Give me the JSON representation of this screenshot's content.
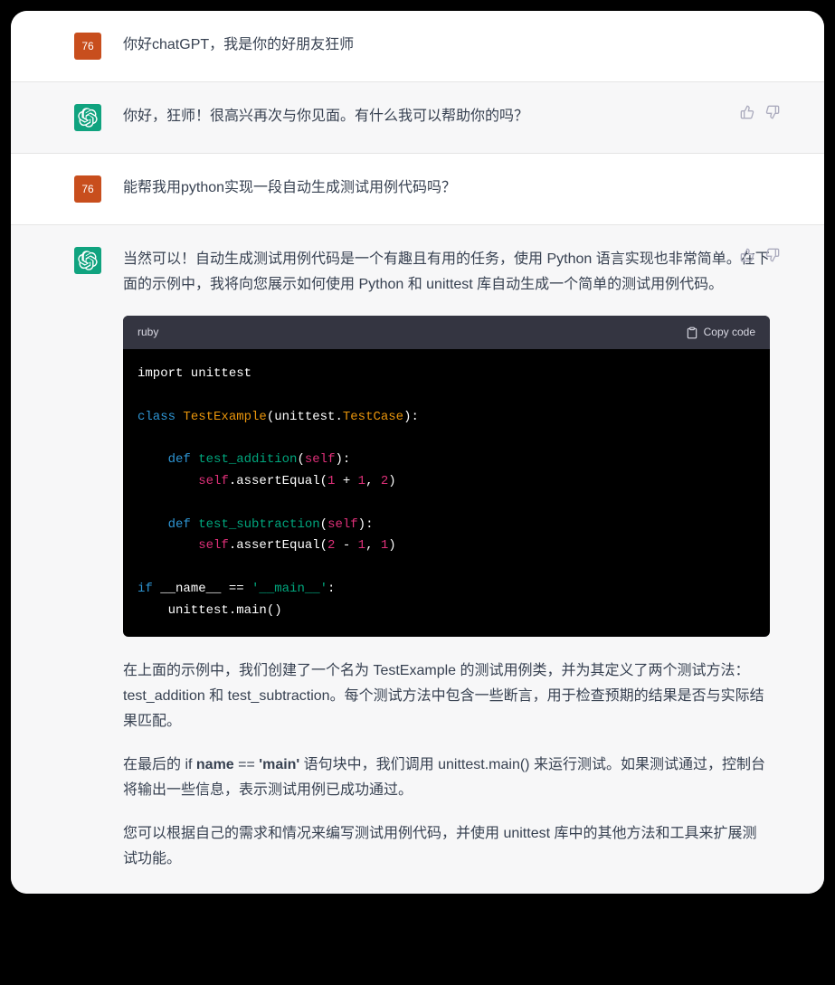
{
  "user_avatar": "76",
  "turns": [
    {
      "role": "user",
      "text": "你好chatGPT，我是你的好朋友狂师"
    },
    {
      "role": "assistant",
      "text": "你好，狂师！很高兴再次与你见面。有什么我可以帮助你的吗？"
    },
    {
      "role": "user",
      "text": "能帮我用python实现一段自动生成测试用例代码吗？"
    }
  ],
  "final": {
    "p1": "当然可以！自动生成测试用例代码是一个有趣且有用的任务，使用 Python 语言实现也非常简单。在下面的示例中，我将向您展示如何使用 Python 和 unittest 库自动生成一个简单的测试用例代码。",
    "code_lang": "ruby",
    "copy_label": "Copy code",
    "code": {
      "l1": "import unittest",
      "l2a": "class",
      "l2b": "TestExample",
      "l2c": "(unittest.",
      "l2d": "TestCase",
      "l2e": "):",
      "l3a": "def",
      "l3b": "test_addition",
      "l3c": "(",
      "l3d": "self",
      "l3e": "):",
      "l4a": "self",
      "l4b": ".assertEqual(",
      "l4c": "1",
      "l4d": " + ",
      "l4e": "1",
      "l4f": ", ",
      "l4g": "2",
      "l4h": ")",
      "l5a": "def",
      "l5b": "test_subtraction",
      "l5c": "(",
      "l5d": "self",
      "l5e": "):",
      "l6a": "self",
      "l6b": ".assertEqual(",
      "l6c": "2",
      "l6d": " - ",
      "l6e": "1",
      "l6f": ", ",
      "l6g": "1",
      "l6h": ")",
      "l7a": "if",
      "l7b": " __name__ == ",
      "l7c": "'__main__'",
      "l7d": ":",
      "l8": "    unittest.main()"
    },
    "p2_pre": "在上面的示例中，我们创建了一个名为 TestExample 的测试用例类，并为其定义了两个测试方法：test_addition 和 test_subtraction。每个测试方法中包含一些断言，用于检查预期的结果是否与实际结果匹配。",
    "p3_a": "在最后的 if ",
    "p3_b1": "name",
    "p3_mid": " == ",
    "p3_b2": "'main'",
    "p3_c": " 语句块中，我们调用 unittest.main() 来运行测试。如果测试通过，控制台将输出一些信息，表示测试用例已成功通过。",
    "p4": "您可以根据自己的需求和情况来编写测试用例代码，并使用 unittest 库中的其他方法和工具来扩展测试功能。"
  }
}
